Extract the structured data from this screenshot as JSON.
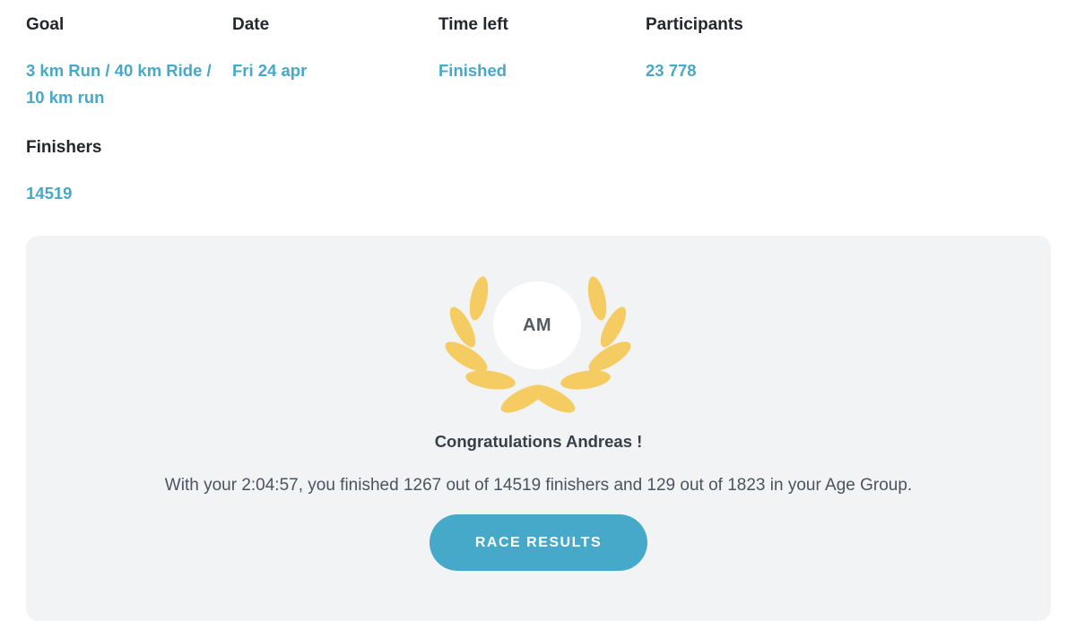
{
  "stats": {
    "goal": {
      "label": "Goal",
      "value_line1": "3 km Run / 40 km Ride /",
      "value_line2": "10 km run"
    },
    "date": {
      "label": "Date",
      "value": "Fri 24 apr"
    },
    "time_left": {
      "label": "Time left",
      "value": "Finished"
    },
    "participants": {
      "label": "Participants",
      "value": "23 778"
    },
    "finishers": {
      "label": "Finishers",
      "value": "14519"
    }
  },
  "result_card": {
    "avatar_initials": "AM",
    "congrats": "Congratulations Andreas !",
    "summary": "With your 2:04:57, you finished 1267 out of 14519 finishers and 129 out of 1823 in your Age Group.",
    "button_label": "RACE RESULTS",
    "laurel_icon": "laurel-wreath-icon"
  },
  "colors": {
    "accent": "#46a9c9",
    "label": "#23262b",
    "card_bg": "#f2f3f5",
    "laurel": "#f5cc62"
  }
}
